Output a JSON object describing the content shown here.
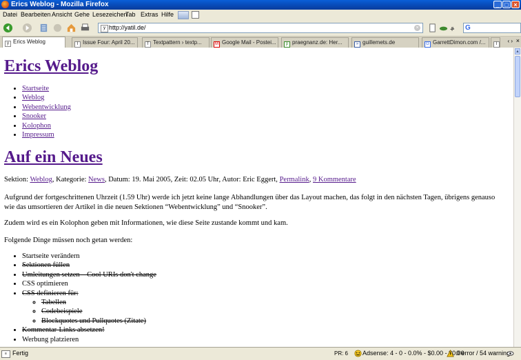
{
  "window": {
    "title": "Erics Weblog - Mozilla Firefox"
  },
  "menu": [
    "Datei",
    "Bearbeiten",
    "Ansicht",
    "Gehe",
    "Lesezeichen",
    "Tab",
    "Extras",
    "Hilfe"
  ],
  "address": {
    "url": "http://yatil.de/"
  },
  "tabs": [
    {
      "label": "Erics Weblog",
      "active": true
    },
    {
      "label": "Issue Four: April 20..."
    },
    {
      "label": "Textpattern › textp..."
    },
    {
      "label": "Google Mail - Postei..."
    },
    {
      "label": "praegnanz.de: Her..."
    },
    {
      "label": "guillemets.de"
    },
    {
      "label": "GarrettDimon.com /..."
    }
  ],
  "page": {
    "site_title": "Erics Weblog",
    "nav": [
      "Startseite",
      "Weblog",
      "Webentwicklung",
      "Snooker",
      "Kolophon",
      "Impressum"
    ],
    "post_title": "Auf ein Neues",
    "meta": {
      "section_label": "Sektion:",
      "section": "Weblog",
      "category_label": ", Kategorie:",
      "category": "News",
      "date_text": ", Datum: 19. Mai 2005, Zeit: 02.05 Uhr, Autor: Eric Eggert,",
      "permalink": "Permalink",
      "comments": "9 Kommentare"
    },
    "paragraphs": [
      "Aufgrund der fortgeschrittenen Uhrzeit (1.59 Uhr) werde ich jetzt keine lange Abhandlungen über das Layout machen, das folgt in den nächsten Tagen, übrigens genauso wie das umsortieren der Artikel in die neuen Sektionen “Webentwicklung” und “Snooker”.",
      "Zudem wird es ein Kolophon geben mit Informationen, wie diese Seite zustande kommt und kam.",
      "Folgende Dinge müssen noch getan werden:"
    ],
    "todo": [
      {
        "text": "Startseite verändern",
        "done": false
      },
      {
        "text": "Sektionen füllen",
        "done": true
      },
      {
        "text": "Umleitungen setzen – Cool URIs don't change",
        "done": true
      },
      {
        "text": "CSS optimieren",
        "done": false
      },
      {
        "text": "CSS definieren für:",
        "done": true
      },
      {
        "text": "Kommentar-Links absetzen!",
        "done": true
      },
      {
        "text": "Werbung platzieren",
        "done": false
      }
    ],
    "css_sub": [
      "Tabellen",
      "Codebeispiele",
      "Blockquotes und Pullquotes (Zitate)"
    ]
  },
  "status": {
    "text": "Fertig",
    "pr": "PR: 6",
    "adsense": "Adsense: 4 - 0 - 0.0% - $0.00 - $0.00",
    "errors": "0 error / 54 warnings"
  }
}
